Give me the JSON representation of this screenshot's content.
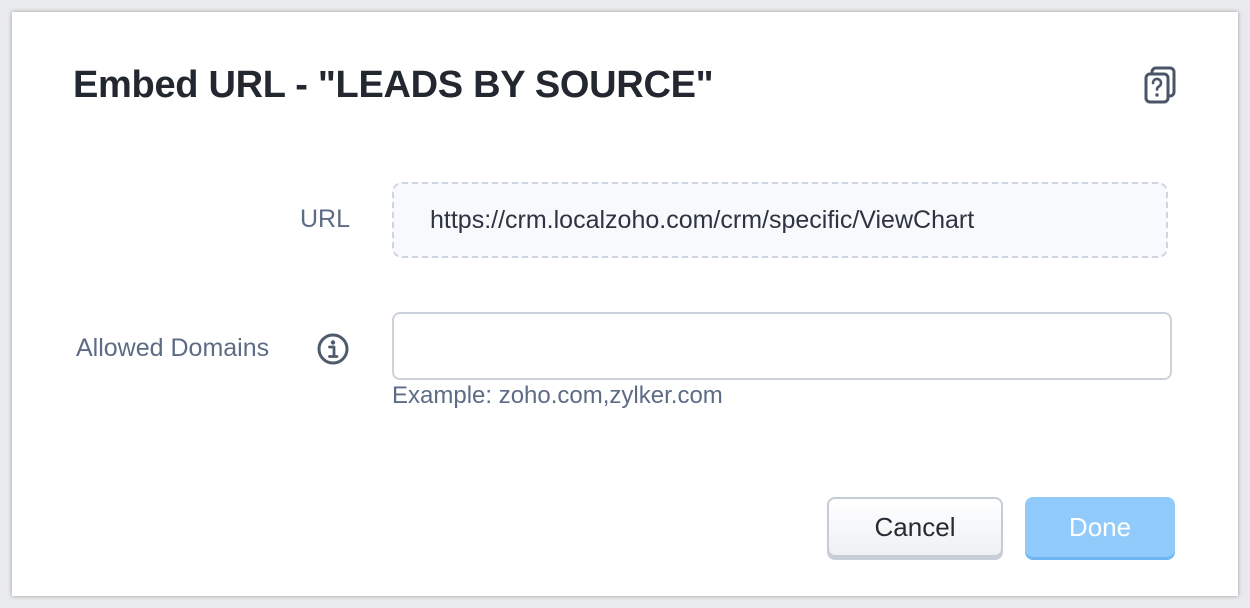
{
  "dialog": {
    "title": "Embed URL - \"LEADS BY SOURCE\"",
    "help_icon": "help-document-icon"
  },
  "form": {
    "url_label": "URL",
    "url_value": "https://crm.localzoho.com/crm/specific/ViewChart",
    "domains_label": "Allowed Domains",
    "domains_info_icon": "info-icon",
    "domains_value": "",
    "domains_hint": "Example: zoho.com,zylker.com"
  },
  "footer": {
    "cancel_label": "Cancel",
    "done_label": "Done"
  },
  "colors": {
    "primary_disabled": "#91cbfb",
    "label": "#5d6b85",
    "title": "#222730"
  }
}
